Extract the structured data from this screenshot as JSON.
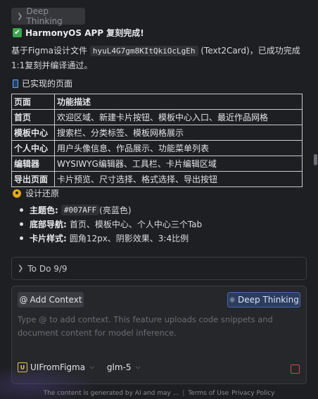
{
  "thinking_chip": {
    "label": "Deep Thinking"
  },
  "done_message": "HarmonyOS APP 复刻完成!",
  "intro": {
    "prefix": "基于Figma设计文件 ",
    "file_id": "hyuL4G7gm8KItQkiOcLgEh",
    "suffix": " (Text2Card)，已成功完成1:1复刻并编译通过。"
  },
  "pages_section": {
    "title": "已实现的页面"
  },
  "pages_table": {
    "headers": [
      "页面",
      "功能描述"
    ],
    "rows": [
      [
        "首页",
        "欢迎区域、新建卡片按钮、模板中心入口、最近作品网格"
      ],
      [
        "模板中心",
        "搜索栏、分类标签、模板网格展示"
      ],
      [
        "个人中心",
        "用户头像信息、作品展示、功能菜单列表"
      ],
      [
        "编辑器",
        "WYSIWYG编辑器、工具栏、卡片编辑区域"
      ],
      [
        "导出页面",
        "卡片预览、尺寸选择、格式选择、导出按钮"
      ]
    ]
  },
  "design_section": {
    "title": "设计还原"
  },
  "design_bullets": [
    {
      "label": "主题色:",
      "code": "#007AFF",
      "text": " (亮蓝色)"
    },
    {
      "label": "底部导航:",
      "code": "",
      "text": "首页、模板中心、个人中心三个Tab"
    },
    {
      "label": "卡片样式:",
      "code": "",
      "text": "圆角12px、阴影效果、3:4比例"
    }
  ],
  "todo": {
    "label": "To Do",
    "count": "9/9"
  },
  "composer": {
    "add_context_label": "Add Context",
    "deep_thinking_label": "Deep Thinking",
    "placeholder": "Type @ to add context. This feature uploads code snippets and document content for model inference.",
    "agent_icon_text": "U",
    "agent_name": "UIFromFigma",
    "model_name": "glm-5"
  },
  "footer": {
    "disclaimer": "The content is generated by AI and may ...",
    "terms": "Terms of Use",
    "privacy": "Privacy Policy"
  },
  "colors": {
    "background": "#1e1f22",
    "accent_blue": "#4268a8",
    "check_green": "#3aa64f",
    "stop_red": "#d14b4b"
  }
}
